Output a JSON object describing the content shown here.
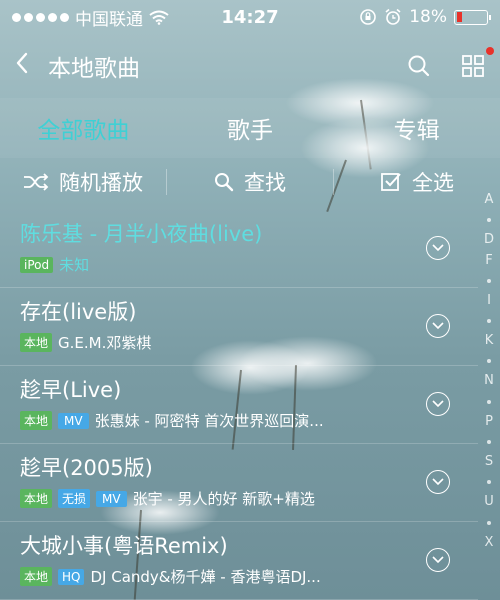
{
  "status": {
    "carrier": "中国联通",
    "time": "14:27",
    "battery": "18%",
    "battery_level": 0.18,
    "battery_color": "#e8322a"
  },
  "nav": {
    "title": "本地歌曲",
    "back_icon": "chevron-left-icon",
    "search_icon": "search-icon",
    "grid_icon": "grid-icon"
  },
  "tabs": [
    {
      "label": "全部歌曲",
      "active": true
    },
    {
      "label": "歌手",
      "active": false
    },
    {
      "label": "专辑",
      "active": false
    }
  ],
  "actions": {
    "shuffle": "随机播放",
    "search": "查找",
    "select_all": "全选"
  },
  "songs": [
    {
      "title": "陈乐基 - 月半小夜曲(live)",
      "tags": [
        "iPod"
      ],
      "subtitle": "未知",
      "playing": true
    },
    {
      "title": "存在(live版)",
      "tags": [
        "本地"
      ],
      "subtitle": "G.E.M.邓紫棋",
      "playing": false
    },
    {
      "title": "趁早(Live)",
      "tags": [
        "本地",
        "MV"
      ],
      "subtitle": "张惠妹 - 阿密特 首次世界巡回演...",
      "playing": false
    },
    {
      "title": "趁早(2005版)",
      "tags": [
        "本地",
        "无损",
        "MV"
      ],
      "subtitle": "张宇 - 男人的好 新歌+精选",
      "playing": false
    },
    {
      "title": "大城小事(粤语Remix)",
      "tags": [
        "本地",
        "HQ"
      ],
      "subtitle": "DJ Candy&杨千嬅 - 香港粤语DJ...",
      "playing": false
    }
  ],
  "index_letters": [
    "A",
    "D",
    "F",
    "I",
    "K",
    "N",
    "P",
    "S",
    "U",
    "X"
  ],
  "accent_color": "#3fd0d4"
}
